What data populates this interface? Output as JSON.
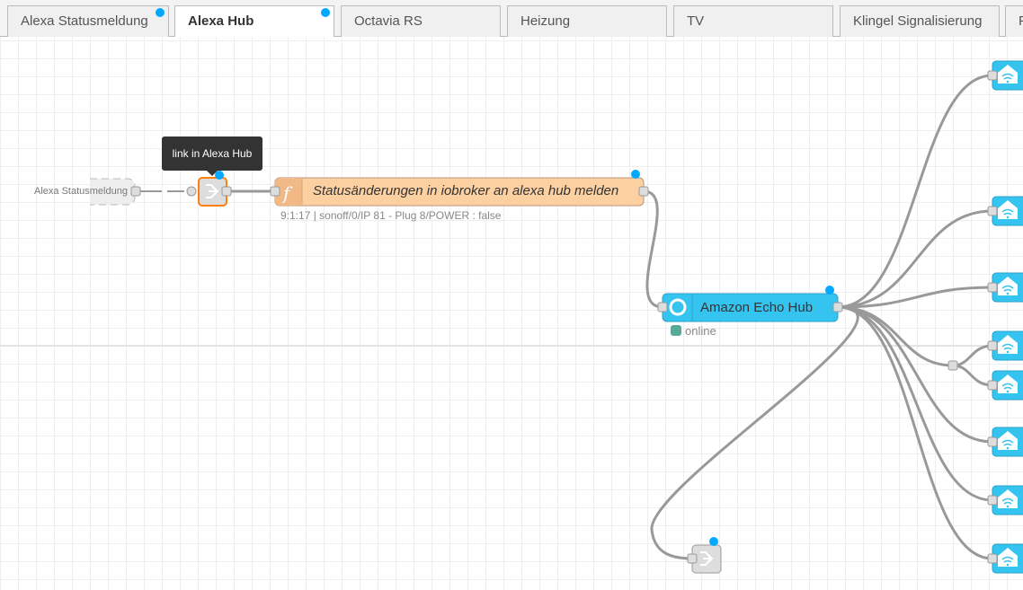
{
  "tabs": [
    {
      "label": "Alexa Statusmeldung",
      "changed": true
    },
    {
      "label": "Alexa Hub",
      "changed": true,
      "active": true
    },
    {
      "label": "Octavia RS"
    },
    {
      "label": "Heizung"
    },
    {
      "label": "TV"
    },
    {
      "label": "Klingel Signalisierung"
    },
    {
      "label": "F"
    }
  ],
  "tooltip": "link in Alexa Hub",
  "nodes": {
    "link_source_label": "Alexa Statusmeldung",
    "function_label": "Statusänderungen in iobroker an alexa hub melden",
    "function_status": "9:1:17 | sonoff/0/IP 81 - Plug 8/POWER : false",
    "echo_label": "Amazon Echo Hub",
    "echo_status": "online"
  },
  "colors": {
    "function": "#fdd0a2",
    "echo": "#35c3ef",
    "device": "#35c3ef",
    "changed": "#00a8ff",
    "status_ok": "#5a9"
  }
}
